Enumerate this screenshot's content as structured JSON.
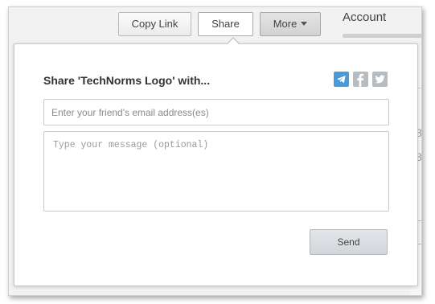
{
  "toolbar": {
    "copy_link_label": "Copy Link",
    "share_label": "Share",
    "more_label": "More",
    "account_label": "Account"
  },
  "share_popup": {
    "title": "Share 'TechNorms Logo' with...",
    "social_icons": [
      "telegram-icon",
      "facebook-icon",
      "twitter-icon"
    ],
    "email_placeholder": "Enter your friend's email address(es)",
    "email_value": "",
    "message_placeholder": "Type your message (optional)",
    "message_value": "",
    "send_label": "Send"
  },
  "background_fragments": {
    "chars": [
      "8",
      "8"
    ],
    "button_fragment": "e"
  },
  "colors": {
    "telegram_active": "#4a9ad9",
    "social_inactive": "#b7bcc3",
    "send_button": "#d8dbde"
  }
}
